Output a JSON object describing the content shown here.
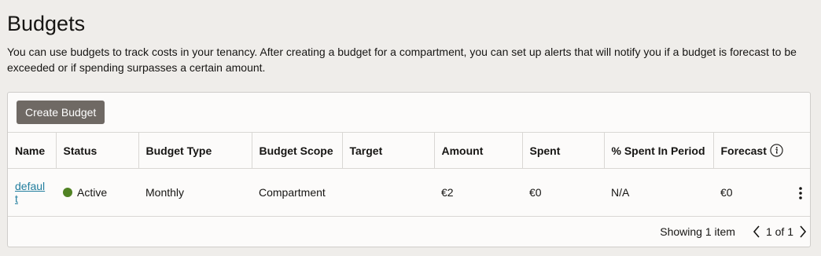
{
  "page": {
    "title": "Budgets",
    "description": "You can use budgets to track costs in your tenancy. After creating a budget for a compartment, you can set up alerts that will notify you if a budget is forecast to be exceeded or if spending surpasses a certain amount."
  },
  "toolbar": {
    "create_label": "Create Budget"
  },
  "table": {
    "columns": [
      "Name",
      "Status",
      "Budget Type",
      "Budget Scope",
      "Target",
      "Amount",
      "Spent",
      "% Spent In Period",
      "Forecast"
    ],
    "rows": [
      {
        "name": "default",
        "status": "Active",
        "budget_type": "Monthly",
        "budget_scope": "Compartment",
        "target": "",
        "amount": "€2",
        "spent": "€0",
        "spent_pct": "N/A",
        "forecast": "€0"
      }
    ]
  },
  "footer": {
    "showing": "Showing 1 item",
    "page_of": "1 of 1"
  },
  "colors": {
    "status_active": "#508223",
    "button_bg": "#6f6964",
    "link": "#227e9e"
  },
  "icons": {
    "forecast_info": "info-icon",
    "row_actions": "kebab-menu-icon",
    "prev": "chevron-left-icon",
    "next": "chevron-right-icon"
  }
}
